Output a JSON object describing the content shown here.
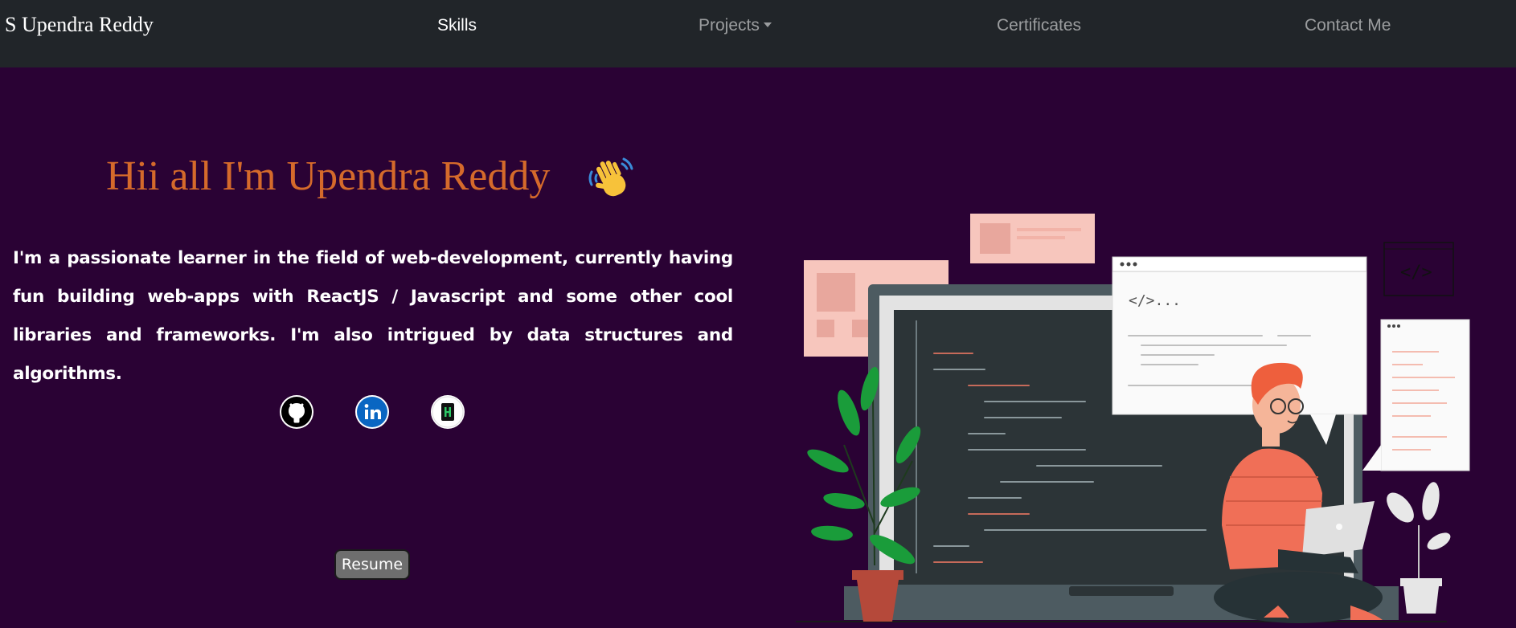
{
  "navbar": {
    "brand": "S Upendra Reddy",
    "links": [
      {
        "label": "Skills",
        "active": true
      },
      {
        "label": "Projects",
        "dropdown": true
      },
      {
        "label": "Certificates"
      },
      {
        "label": "Contact Me"
      }
    ]
  },
  "hero": {
    "title": "Hii all I'm Upendra Reddy",
    "wave_icon": "waving-hand-icon",
    "bio": "I'm a passionate learner in the field of web-development, currently having fun building web-apps with ReactJS / Javascript and some other cool libraries and frameworks. I'm also intrigued by data structures and algorithms.",
    "social_icons": [
      "github-icon",
      "linkedin-icon",
      "hackerrank-icon"
    ],
    "resume_label": "Resume",
    "illustration_code_text": "</>...",
    "illustration_small_code": "</>"
  },
  "colors": {
    "background": "#2a0234",
    "navbar": "#212529",
    "title": "#d56a2b",
    "resume_button": "#6e6e6e"
  }
}
